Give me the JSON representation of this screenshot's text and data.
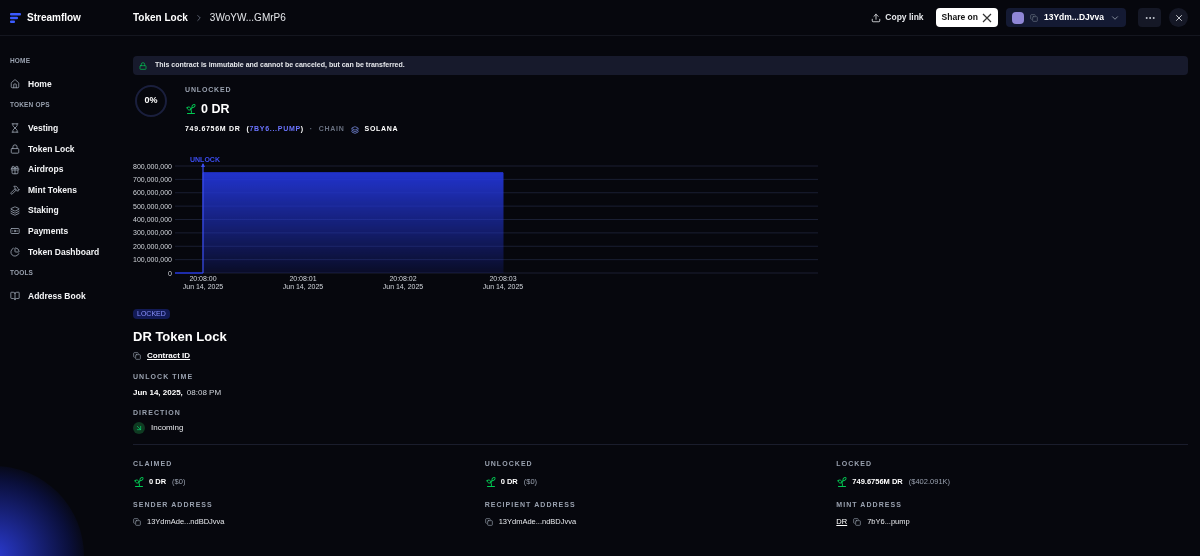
{
  "app": {
    "name": "Streamflow"
  },
  "breadcrumb": [
    {
      "label": "Token Lock"
    },
    {
      "label": "3WoYW...GMrP6"
    }
  ],
  "header_actions": {
    "copy_link": "Copy link",
    "share": "Share on",
    "wallet": "13Ydm...DJvva"
  },
  "sidebar": {
    "sections": [
      {
        "title": "HOME",
        "items": [
          {
            "label": "Home",
            "kind": "home"
          }
        ]
      },
      {
        "title": "TOKEN OPS",
        "items": [
          {
            "label": "Vesting",
            "kind": "vesting"
          },
          {
            "label": "Token Lock",
            "kind": "lock"
          },
          {
            "label": "Airdrops",
            "kind": "airdrop"
          },
          {
            "label": "Mint Tokens",
            "kind": "mint"
          },
          {
            "label": "Staking",
            "kind": "staking"
          },
          {
            "label": "Payments",
            "kind": "payments"
          },
          {
            "label": "Token Dashboard",
            "kind": "dashboard"
          }
        ]
      },
      {
        "title": "TOOLS",
        "items": [
          {
            "label": "Address Book",
            "kind": "book"
          }
        ]
      }
    ]
  },
  "notice": "This contract is immutable and cannot be canceled, but can be transferred.",
  "progress": {
    "label": "0%",
    "level": 0
  },
  "unlocked_summary": {
    "title": "UNLOCKED",
    "amount": "0 DR",
    "total": "749.6756M DR",
    "paren_open": "(",
    "mint_link": "7BY6...PUMP",
    "paren_close": ")",
    "separator": "·",
    "chain_label": "CHAIN",
    "chain": "SOLANA"
  },
  "chart_data": {
    "type": "area",
    "categories": [
      "20:08:00\nJun 14, 2025",
      "20:08:01\nJun 14, 2025",
      "20:08:02\nJun 14, 2025",
      "20:08:03\nJun 14, 2025"
    ],
    "ylim": [
      0,
      800000000
    ],
    "yticks": [
      {
        "value": 0,
        "label": "0"
      },
      {
        "value": 100000000,
        "label": "100,000,000"
      },
      {
        "value": 200000000,
        "label": "200,000,000"
      },
      {
        "value": 300000000,
        "label": "300,000,000"
      },
      {
        "value": 400000000,
        "label": "400,000,000"
      },
      {
        "value": 500000000,
        "label": "500,000,000"
      },
      {
        "value": 600000000,
        "label": "600,000,000"
      },
      {
        "value": 700000000,
        "label": "700,000,000"
      },
      {
        "value": 800000000,
        "label": "800,000,000"
      }
    ],
    "series": [
      {
        "color": "#2336d8",
        "values": [
          750000000,
          750000000,
          750000000,
          750000000
        ]
      }
    ],
    "grid": true,
    "annotations": [
      "UNLOCK"
    ]
  },
  "contract": {
    "status": "LOCKED",
    "title": "DR Token Lock",
    "contract_id": "Contract ID",
    "unlock_time_label": "UNLOCK TIME",
    "unlock_date": "Jun 14, 2025,",
    "unlock_clock": "08:08 PM",
    "direction_label": "DIRECTION",
    "direction": "Incoming"
  },
  "stats": [
    {
      "label": "CLAIMED",
      "amount": "0 DR",
      "usd": "($0)"
    },
    {
      "label": "UNLOCKED",
      "amount": "0 DR",
      "usd": "($0)"
    },
    {
      "label": "LOCKED",
      "amount": "749.6756M DR",
      "usd": "($402.091K)"
    }
  ],
  "addresses": [
    {
      "label": "SENDER ADDRESS",
      "value": "13YdmAde...ndBDJvva"
    },
    {
      "label": "RECIPIENT ADDRESS",
      "value": "13YdmAde...ndBDJvva"
    },
    {
      "label": "MINT ADDRESS",
      "symbol": "DR",
      "value": "7bY6...pump"
    }
  ]
}
